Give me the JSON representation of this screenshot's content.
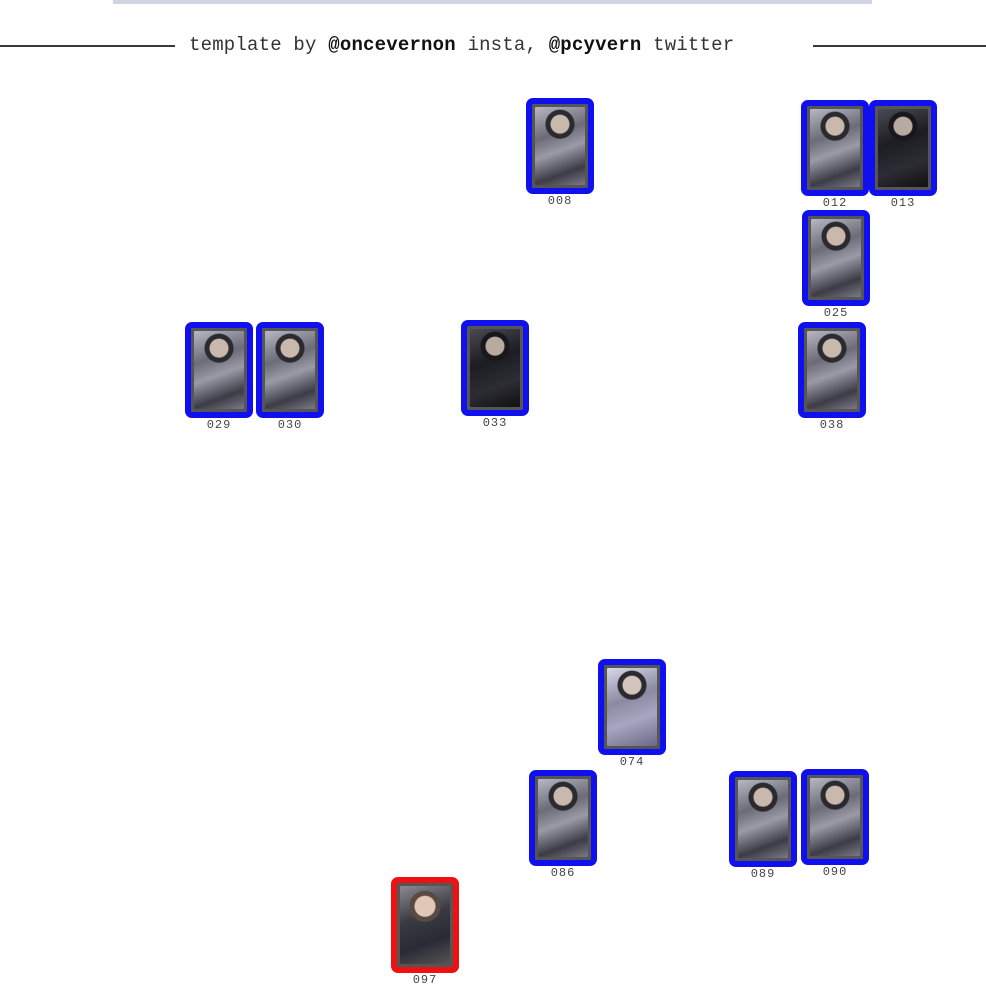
{
  "header": {
    "credit_prefix": "template by ",
    "insta_handle": "@oncevernon",
    "insta_suffix": " insta, ",
    "twitter_handle": "@pcyvern",
    "twitter_suffix": " twitter"
  },
  "colors": {
    "owned_frame": "#1010ee",
    "wishlist_frame": "#ee1111",
    "top_bar": "#cfd3e2"
  },
  "cards": [
    {
      "number": "008",
      "status": "owned"
    },
    {
      "number": "012",
      "status": "owned"
    },
    {
      "number": "013",
      "status": "owned"
    },
    {
      "number": "025",
      "status": "owned"
    },
    {
      "number": "029",
      "status": "owned"
    },
    {
      "number": "030",
      "status": "owned"
    },
    {
      "number": "033",
      "status": "owned"
    },
    {
      "number": "038",
      "status": "owned"
    },
    {
      "number": "074",
      "status": "owned"
    },
    {
      "number": "086",
      "status": "owned"
    },
    {
      "number": "089",
      "status": "owned"
    },
    {
      "number": "090",
      "status": "owned"
    },
    {
      "number": "097",
      "status": "wishlist"
    }
  ]
}
